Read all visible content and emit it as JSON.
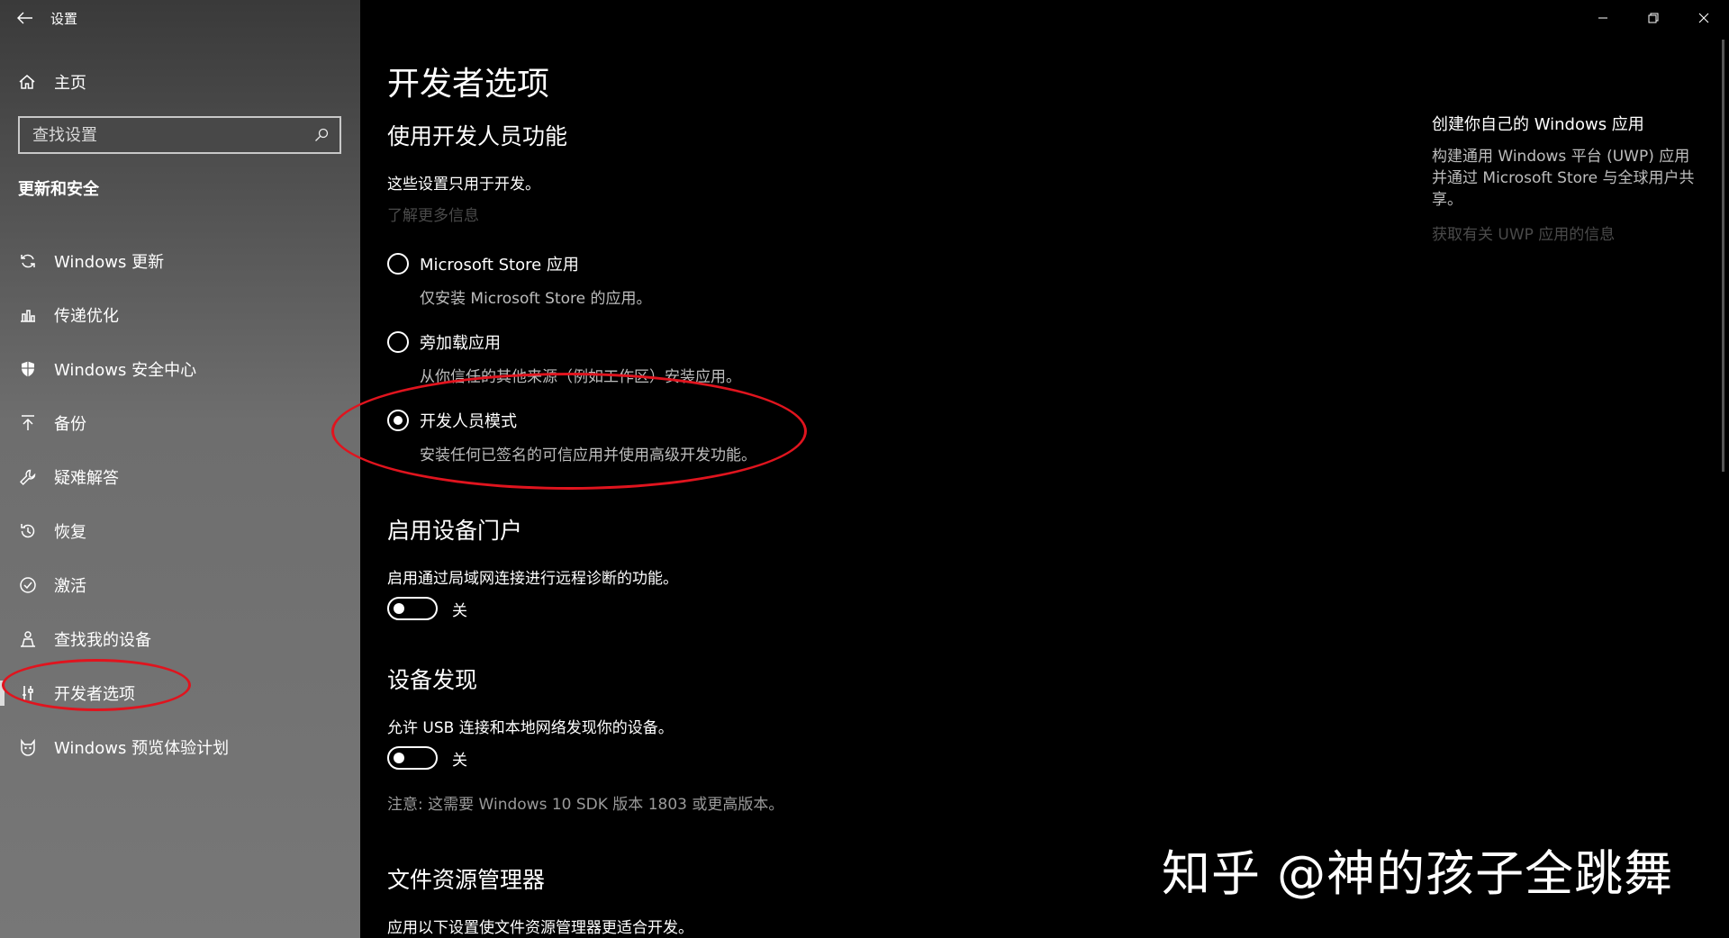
{
  "window": {
    "title": "设置"
  },
  "sidebar": {
    "home_label": "主页",
    "search_placeholder": "查找设置",
    "section_title": "更新和安全",
    "items": [
      {
        "label": "Windows 更新",
        "icon": "sync-icon"
      },
      {
        "label": "传递优化",
        "icon": "delivery-optimization-icon"
      },
      {
        "label": "Windows 安全中心",
        "icon": "shield-icon"
      },
      {
        "label": "备份",
        "icon": "backup-arrow-up-icon"
      },
      {
        "label": "疑难解答",
        "icon": "wrench-icon"
      },
      {
        "label": "恢复",
        "icon": "history-icon"
      },
      {
        "label": "激活",
        "icon": "check-circle-icon"
      },
      {
        "label": "查找我的设备",
        "icon": "person-locate-icon"
      },
      {
        "label": "开发者选项",
        "icon": "developer-tools-icon",
        "selected": true
      },
      {
        "label": "Windows 预览体验计划",
        "icon": "insider-cat-icon"
      }
    ]
  },
  "main": {
    "page_title": "开发者选项",
    "dev_features": {
      "heading": "使用开发人员功能",
      "description": "这些设置只用于开发。",
      "learn_more": "了解更多信息",
      "options": [
        {
          "label": "Microsoft Store 应用",
          "sub": "仅安装 Microsoft Store 的应用。",
          "checked": false
        },
        {
          "label": "旁加载应用",
          "sub": "从你信任的其他来源（例如工作区）安装应用。",
          "checked": false
        },
        {
          "label": "开发人员模式",
          "sub": "安装任何已签名的可信应用并使用高级开发功能。",
          "checked": true
        }
      ]
    },
    "device_portal": {
      "heading": "启用设备门户",
      "description": "启用通过局域网连接进行远程诊断的功能。",
      "toggle_state": "关"
    },
    "device_discovery": {
      "heading": "设备发现",
      "description": "允许 USB 连接和本地网络发现你的设备。",
      "toggle_state": "关",
      "note": "注意: 这需要 Windows 10 SDK 版本 1803 或更高版本。"
    },
    "file_explorer": {
      "heading": "文件资源管理器",
      "description": "应用以下设置使文件资源管理器更适合开发。"
    }
  },
  "right_panel": {
    "title": "创建你自己的 Windows 应用",
    "body": "构建通用 Windows 平台 (UWP) 应用并通过 Microsoft Store 与全球用户共享。",
    "link": "获取有关 UWP 应用的信息"
  },
  "watermark": "知乎 @神的孩子全跳舞",
  "colors": {
    "annotation_red": "#e0141e",
    "link_gray": "#4a4a4a"
  }
}
